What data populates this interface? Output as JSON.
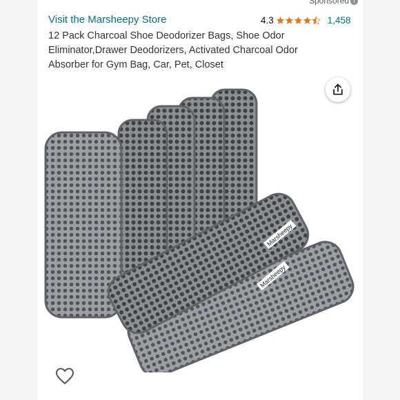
{
  "header": {
    "sponsored_label": "Sponsored",
    "store_link": "Visit the Marsheepy Store",
    "rating_value": "4.3",
    "rating_stars": 4.3,
    "rating_count": "1,458"
  },
  "product": {
    "title": "12 Pack Charcoal Shoe Deodorizer Bags, Shoe Odor Eliminator,Drawer Deodorizers, Activated Charcoal Odor Absorber for Gym Bag, Car, Pet, Closet",
    "tag_brand": "Marsheepy"
  },
  "icons": {
    "share": "share-icon",
    "wishlist": "heart-icon",
    "info": "info-icon",
    "star": "star-icon"
  },
  "colors": {
    "link": "#007185",
    "star": "#de7921",
    "mesh": "#6a6d72"
  }
}
